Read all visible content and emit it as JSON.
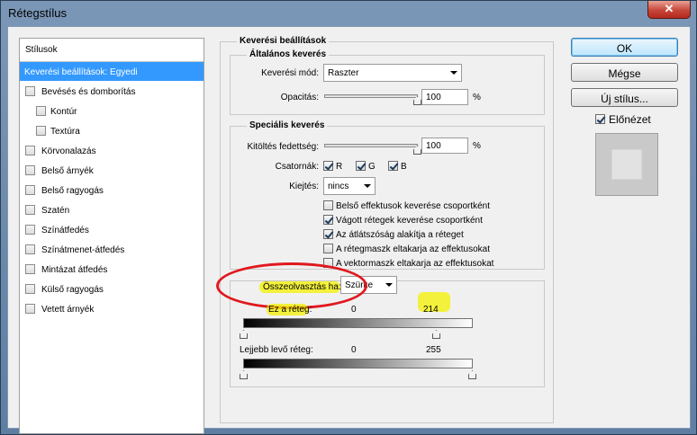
{
  "window": {
    "title": "Rétegstílus",
    "close_glyph": "✕"
  },
  "sidebar": {
    "header": "Stílusok",
    "items": [
      {
        "label": "Keverési beállítások: Egyedi",
        "selected": true,
        "checkbox": false
      },
      {
        "label": "Bevésés és domborítás",
        "checkbox": true
      },
      {
        "label": "Kontúr",
        "checkbox": true,
        "sub": true
      },
      {
        "label": "Textúra",
        "checkbox": true,
        "sub": true
      },
      {
        "label": "Körvonalazás",
        "checkbox": true
      },
      {
        "label": "Belső árnyék",
        "checkbox": true
      },
      {
        "label": "Belső ragyogás",
        "checkbox": true
      },
      {
        "label": "Szatén",
        "checkbox": true
      },
      {
        "label": "Színátfedés",
        "checkbox": true
      },
      {
        "label": "Színátmenet-átfedés",
        "checkbox": true
      },
      {
        "label": "Mintázat átfedés",
        "checkbox": true
      },
      {
        "label": "Külső ragyogás",
        "checkbox": true
      },
      {
        "label": "Vetett árnyék",
        "checkbox": true
      }
    ]
  },
  "blending": {
    "section_title": "Keverési beállítások",
    "general": {
      "title": "Általános keverés",
      "blend_mode_label": "Keverési mód:",
      "blend_mode_value": "Raszter",
      "opacity_label": "Opacitás:",
      "opacity_value": "100",
      "opacity_fraction": 1.0,
      "percent": "%"
    },
    "advanced": {
      "title": "Speciális keverés",
      "fill_label": "Kitöltés fedettség:",
      "fill_value": "100",
      "fill_fraction": 1.0,
      "percent": "%",
      "channels_label": "Csatornák:",
      "channels": [
        {
          "label": "R",
          "checked": true
        },
        {
          "label": "G",
          "checked": true
        },
        {
          "label": "B",
          "checked": true
        }
      ],
      "knockout_label": "Kiejtés:",
      "knockout_value": "nincs",
      "options": [
        {
          "label": "Belső effektusok keverése csoportként",
          "checked": false
        },
        {
          "label": "Vágott rétegek keverése csoportként",
          "checked": true
        },
        {
          "label": "Az átlátszóság alakítja a réteget",
          "checked": true
        },
        {
          "label": "A rétegmaszk eltakarja az effektusokat",
          "checked": false
        },
        {
          "label": "A vektormaszk eltakarja az effektusokat",
          "checked": false
        }
      ]
    },
    "blend_if": {
      "label": "Összeolvasztás ha:",
      "value": "Szürke",
      "this_layer_label": "Ez a réteg:",
      "this_layer_min": "0",
      "this_layer_max": "214",
      "underlying_label": "Lejjebb levő réteg:",
      "underlying_min": "0",
      "underlying_max": "255"
    }
  },
  "buttons": {
    "ok": "OK",
    "cancel": "Mégse",
    "new_style": "Új stílus...",
    "preview_label": "Előnézet",
    "preview_checked": true
  },
  "colors": {
    "selection": "#3399ff",
    "annotation_circle": "#e0181e",
    "annotation_highlight": "#f4f200"
  }
}
